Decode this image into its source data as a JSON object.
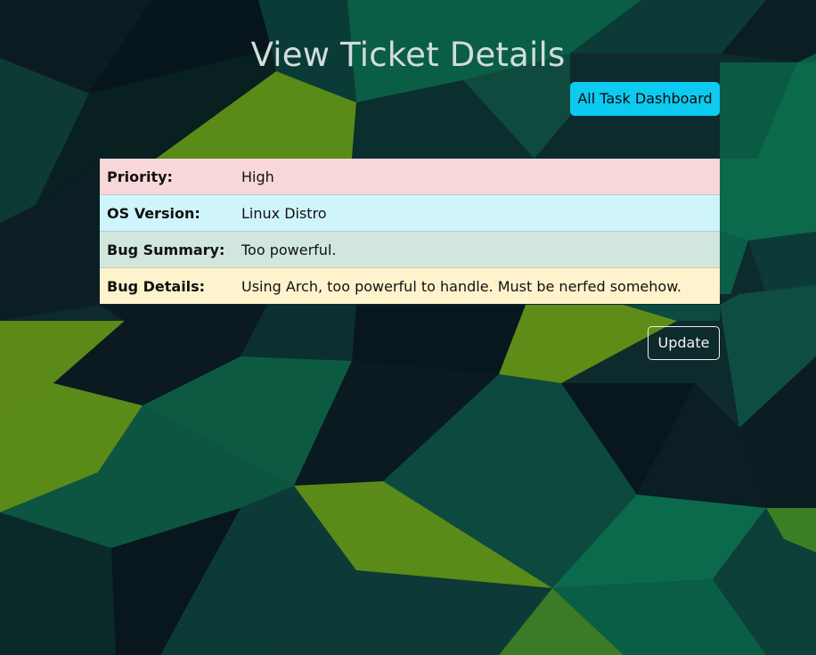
{
  "page": {
    "title": "View Ticket Details"
  },
  "nav": {
    "dashboard_label": "All Task Dashboard"
  },
  "ticket": {
    "rows": [
      {
        "label": "Priority:",
        "value": "High"
      },
      {
        "label": "OS Version:",
        "value": "Linux Distro"
      },
      {
        "label": "Bug Summary:",
        "value": "Too powerful."
      },
      {
        "label": "Bug Details:",
        "value": "Using Arch, too powerful to handle. Must be nerfed somehow."
      }
    ]
  },
  "actions": {
    "update_label": "Update"
  },
  "colors": {
    "dashboard_button": "#0dcaf0",
    "priority_row": "#f8d7da",
    "os_row": "#cff4fc",
    "summary_row": "#d1e7dd",
    "details_row": "#fff3cd"
  }
}
